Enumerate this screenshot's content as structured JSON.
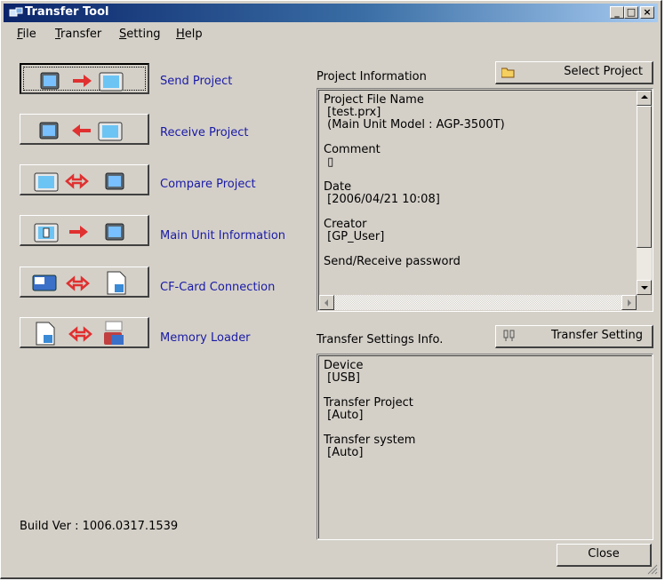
{
  "window": {
    "title": "Transfer Tool",
    "min_glyph": "_",
    "max_glyph": "□",
    "close_glyph": "×"
  },
  "menu": [
    {
      "label": "File",
      "accel": "F",
      "rest": "ile"
    },
    {
      "label": "Transfer",
      "accel": "T",
      "rest": "ransfer"
    },
    {
      "label": "Setting",
      "accel": "S",
      "rest": "etting"
    },
    {
      "label": "Help",
      "accel": "H",
      "rest": "elp"
    }
  ],
  "actions": [
    {
      "label": "Send Project",
      "icon": "send-project-icon"
    },
    {
      "label": "Receive Project",
      "icon": "receive-project-icon"
    },
    {
      "label": "Compare Project",
      "icon": "compare-project-icon"
    },
    {
      "label": "Main Unit Information",
      "icon": "main-unit-info-icon"
    },
    {
      "label": "CF-Card Connection",
      "icon": "cf-card-icon"
    },
    {
      "label": "Memory Loader",
      "icon": "memory-loader-icon"
    }
  ],
  "project_info": {
    "heading": "Project Information",
    "select_button": "Select Project",
    "lines": [
      "Project File Name",
      " [test.prx]",
      " (Main Unit Model : AGP-3500T)",
      "",
      "Comment",
      " ▯",
      "",
      "Date",
      " [2006/04/21 10:08]",
      "",
      "Creator",
      " [GP_User]",
      "",
      "Send/Receive password"
    ]
  },
  "transfer_info": {
    "heading": "Transfer Settings Info.",
    "setting_button": "Transfer Setting",
    "lines": [
      "Device",
      " [USB]",
      "",
      "Transfer Project",
      " [Auto]",
      "",
      "Transfer system",
      " [Auto]"
    ]
  },
  "build_version": "Build Ver : 1006.0317.1539",
  "close_button": "Close",
  "colors": {
    "title_start": "#0a246a",
    "title_end": "#a6caf0",
    "link": "#1a1aa6",
    "face": "#d4d0c8",
    "arrow": "#e03030"
  }
}
